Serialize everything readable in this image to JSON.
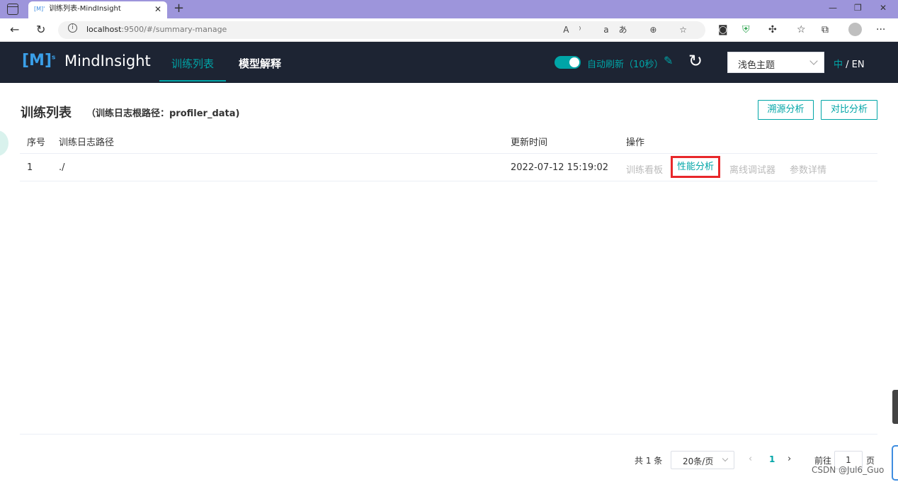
{
  "browser": {
    "tab_title": "训练列表-MindInsight",
    "tab_favicon": "[M]'",
    "url_host": "localhost",
    "url_rest": ":9500/#/summary-manage"
  },
  "header": {
    "logo_mark": "[M]",
    "logo_sup": "s",
    "logo_text": "MindInsight",
    "nav": [
      "训练列表",
      "模型解释"
    ],
    "auto_refresh_label": "自动刷新（10秒）",
    "auto_refresh_on": true,
    "theme_value": "浅色主题",
    "lang_zh": "中",
    "lang_sep": " / ",
    "lang_en": "EN"
  },
  "page": {
    "title": "训练列表",
    "path_note": "（训练日志根路径：profiler_data)",
    "btn_lineage": "溯源分析",
    "btn_compare": "对比分析"
  },
  "table": {
    "headers": [
      "序号",
      "训练日志路径",
      "更新时间",
      "操作"
    ],
    "rows": [
      {
        "index": "1",
        "path": "./",
        "updated": "2022-07-12 15:19:02",
        "ops": [
          "训练看板",
          "性能分析",
          "离线调试器",
          "参数详情"
        ],
        "active_op": "性能分析"
      }
    ]
  },
  "pagination": {
    "total": "共 1 条",
    "page_size": "20条/页",
    "current": "1",
    "goto_label": "前往",
    "goto_value": "1",
    "page_unit": "页"
  },
  "watermark": "CSDN @Jul6_Guo",
  "colors": {
    "accent": "#00a5a7",
    "header_bg": "#1d2433",
    "highlight_box": "#e8272a",
    "tabbar": "#9d95db"
  }
}
